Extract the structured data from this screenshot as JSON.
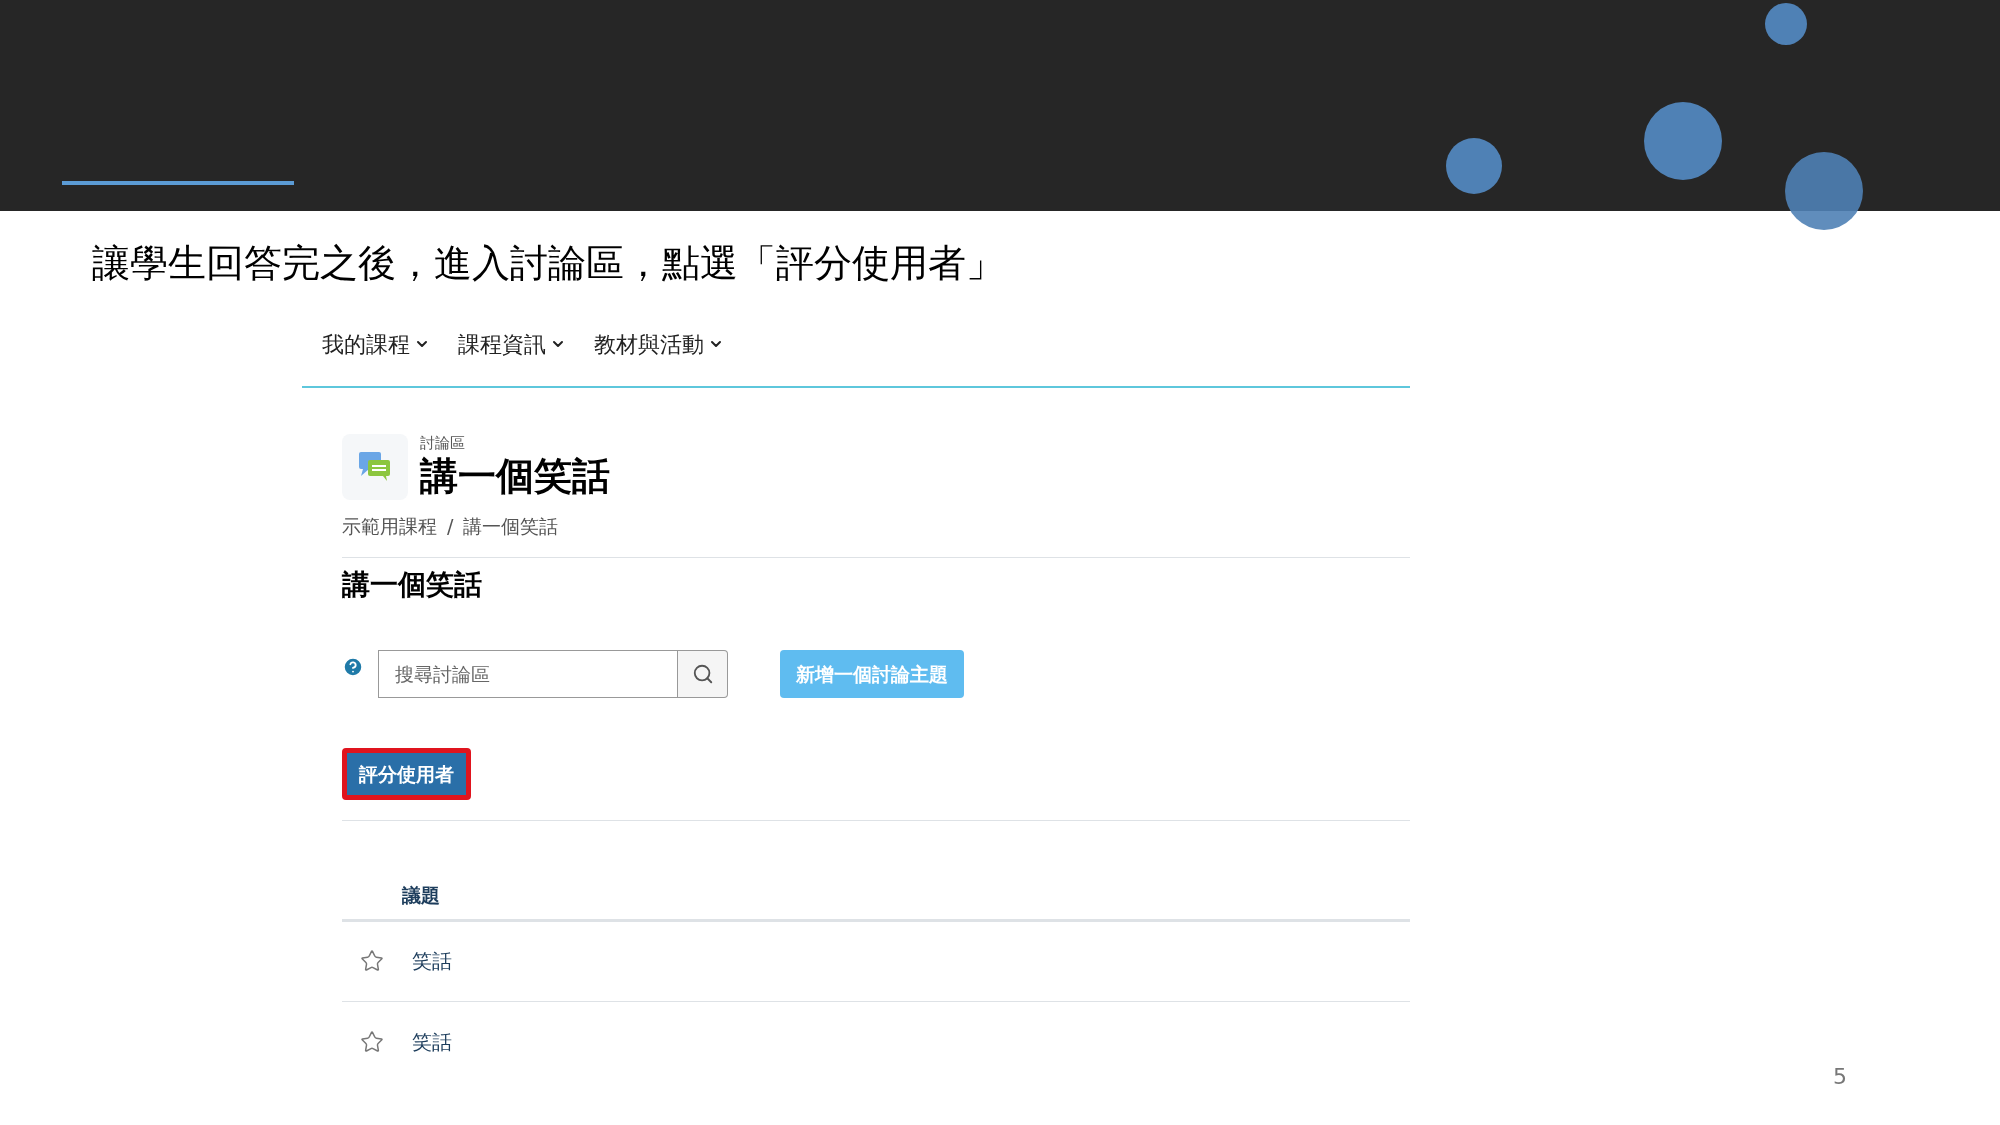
{
  "slide": {
    "caption": "讓學生回答完之後，進入討論區，點選「評分使用者」",
    "page_number": "5"
  },
  "nav": {
    "items": [
      {
        "label": "我的課程"
      },
      {
        "label": "課程資訊"
      },
      {
        "label": "教材與活動"
      }
    ]
  },
  "header": {
    "kind_label": "討論區",
    "title": "講一個笑話"
  },
  "breadcrumb": {
    "separator": "/",
    "items": [
      "示範用課程",
      "講一個笑話"
    ]
  },
  "heading": "講一個笑話",
  "search": {
    "placeholder": "搜尋討論區"
  },
  "add_button": {
    "label": "新增一個討論主題",
    "disabled": true
  },
  "grade_button": {
    "label": "評分使用者",
    "highlighted": true
  },
  "table": {
    "columns": [
      "議題"
    ],
    "rows": [
      {
        "title": "笑話",
        "starred": false
      },
      {
        "title": "笑話",
        "starred": false
      }
    ]
  }
}
